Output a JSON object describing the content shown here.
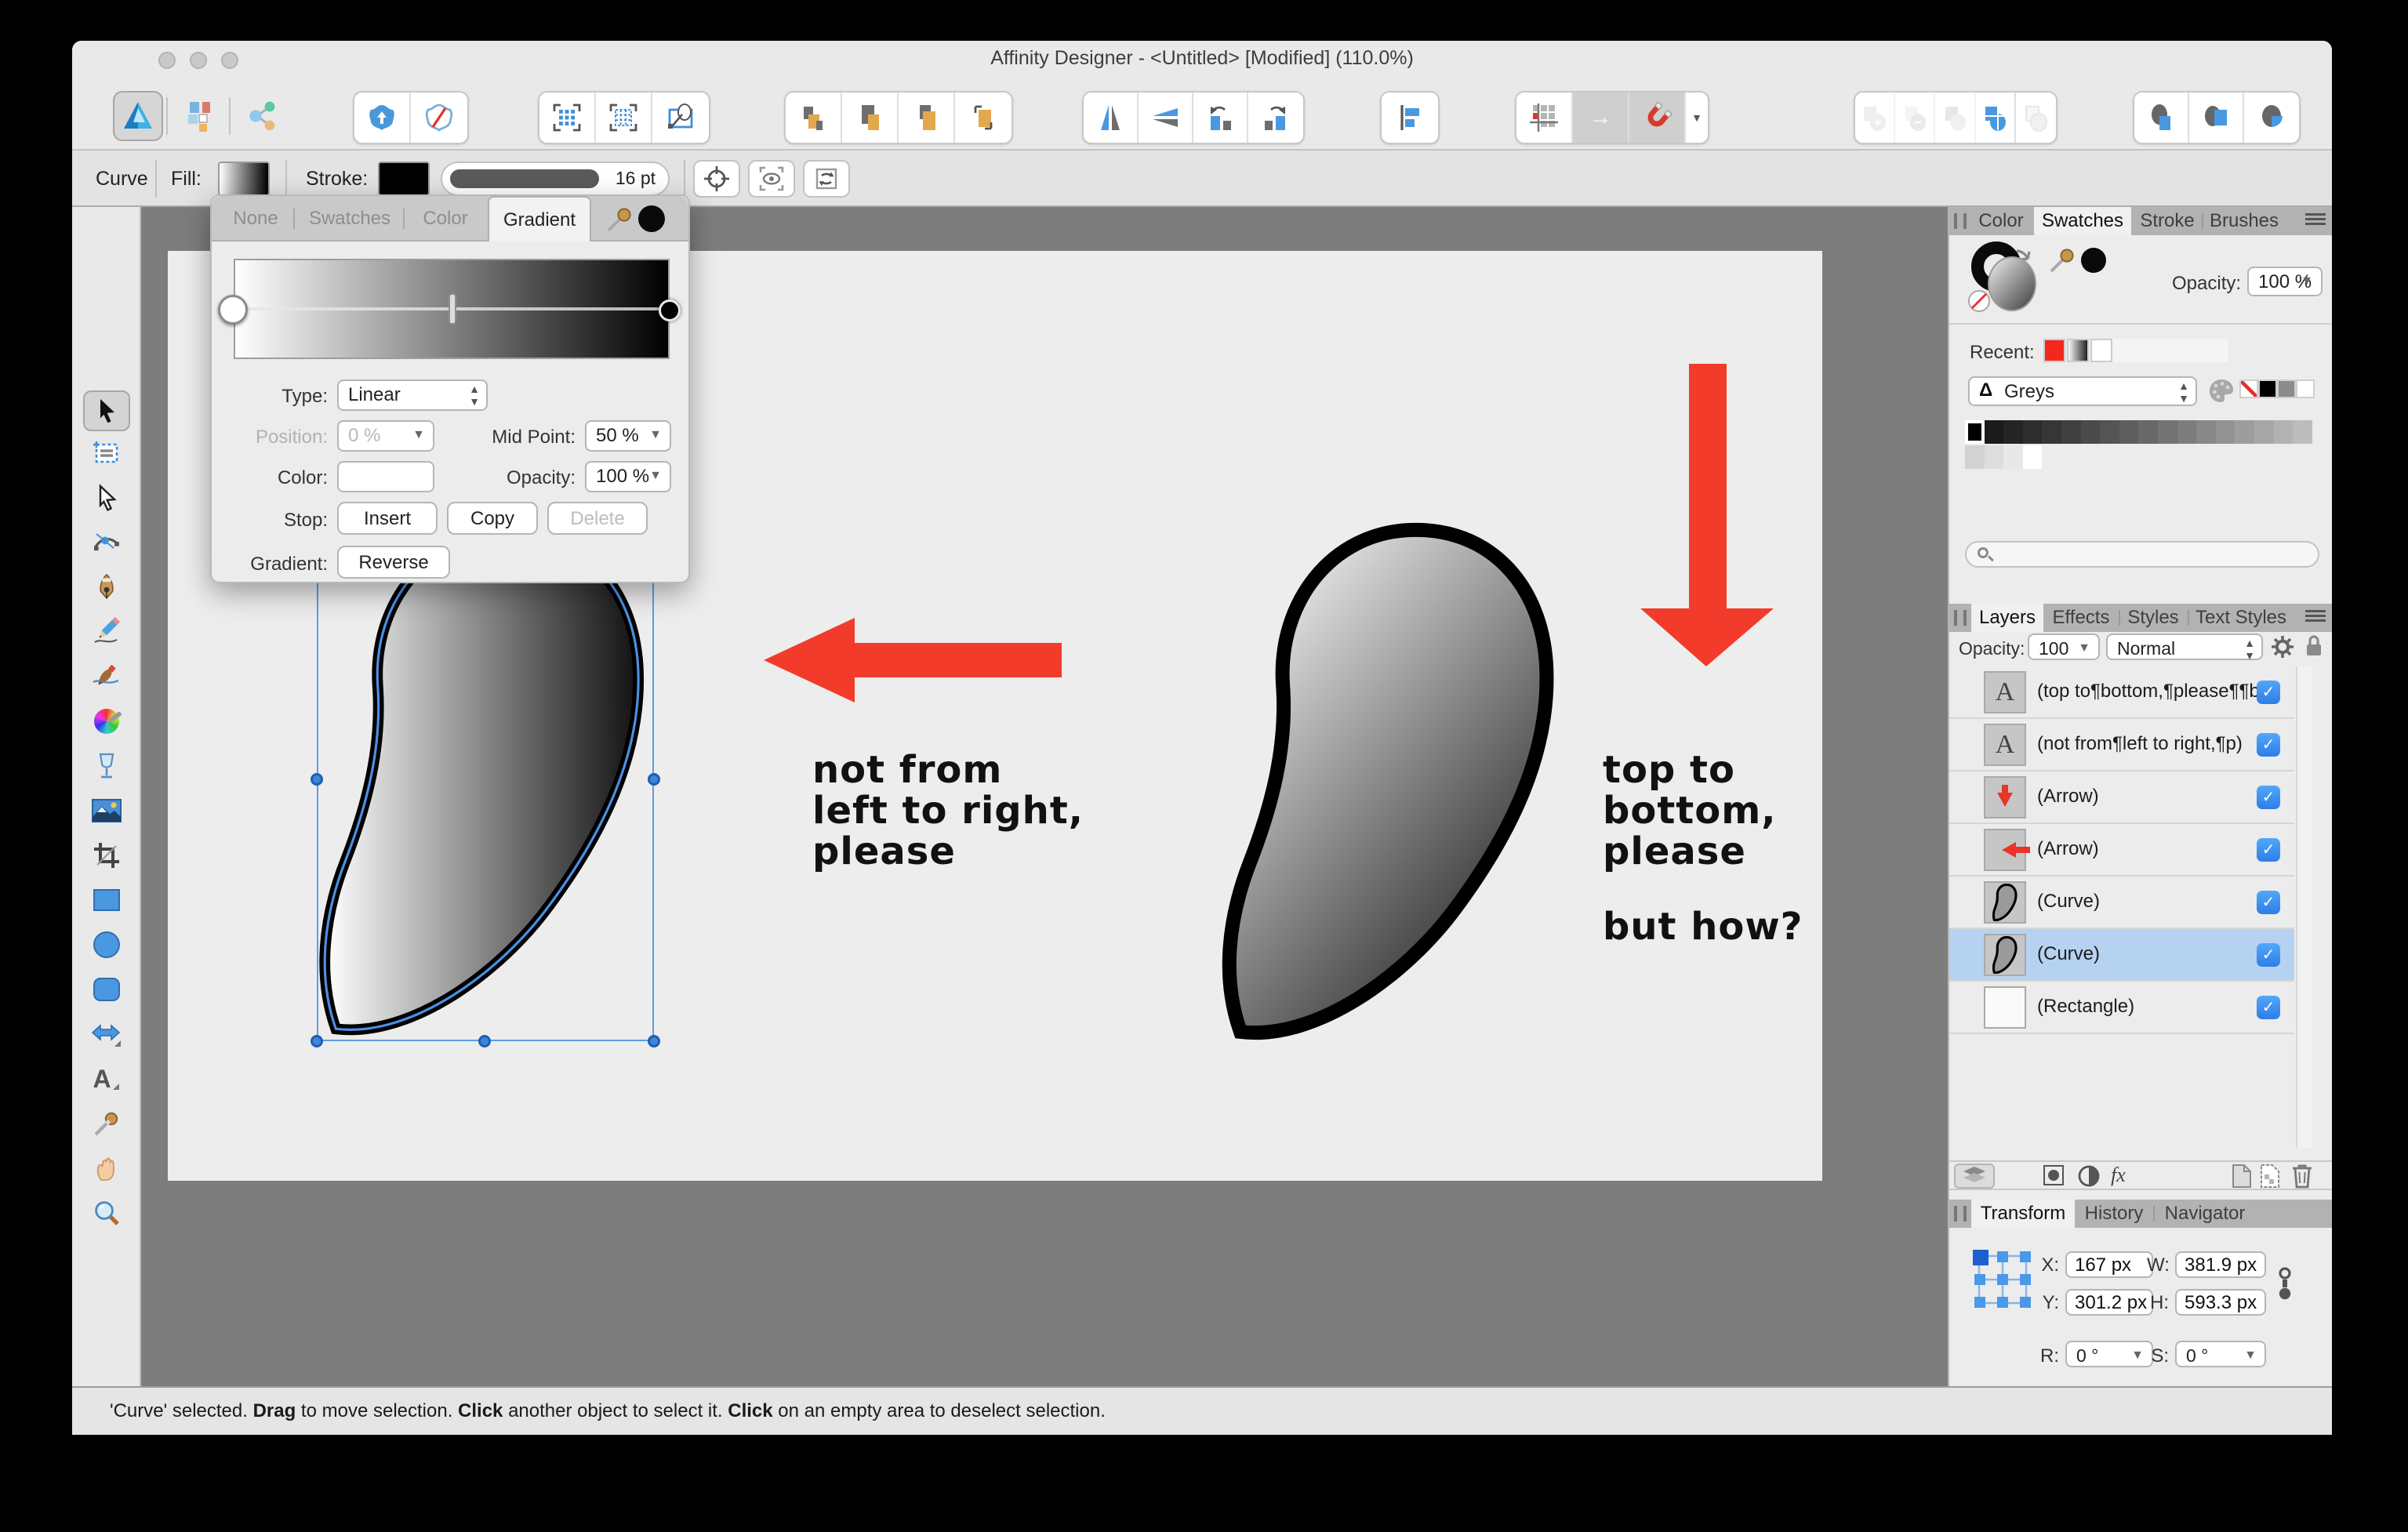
{
  "window": {
    "title": "Affinity Designer - <Untitled> [Modified] (110.0%)"
  },
  "icon_names": [
    "designer-persona-icon",
    "pixel-persona-icon",
    "export-persona-icon",
    "insert-inside-icon",
    "erase-icon",
    "select-box-icon",
    "select-marquee-icon",
    "lasso-transform-icon",
    "move-to-front-icon",
    "move-forward-icon",
    "move-backward-icon",
    "move-to-back-icon",
    "flip-horizontal-icon",
    "flip-vertical-icon",
    "rotate-ccw-icon",
    "rotate-cw-icon",
    "alignment-icon",
    "snap-grid-icon",
    "move-by-whole-pixels-icon",
    "snapping-icon",
    "boolean-add-icon",
    "boolean-subtract-icon",
    "boolean-intersect-icon",
    "boolean-divide-icon",
    "boolean-combine-icon",
    "insert-behind-icon",
    "insert-inside-target-icon",
    "insert-on-top-icon",
    "rotation-centre-icon",
    "cycle-selection-box-icon",
    "transform-objects-separately-icon",
    "eyedropper-icon",
    "hamburger-menu-icon",
    "gear-icon",
    "lock-icon",
    "layers-stack-icon",
    "mask-icon",
    "adjustment-icon",
    "fx-icon",
    "new-layer-icon",
    "new-pixel-layer-icon",
    "trash-icon",
    "link-icon",
    "search-icon",
    "palette-icon"
  ],
  "tools": [
    "move",
    "artboard",
    "node",
    "point-transform",
    "pen",
    "pencil",
    "vector-brush",
    "fill-gradient",
    "transparency",
    "place-image",
    "crop",
    "rectangle",
    "ellipse",
    "rounded-rectangle",
    "arrow-shape",
    "artistic-text",
    "colour-picker",
    "view-hand",
    "zoom"
  ],
  "context_toolbar": {
    "object_label": "Curve",
    "fill_label": "Fill:",
    "stroke_label": "Stroke:",
    "stroke_width": "16 pt"
  },
  "gradient_panel": {
    "tabs": [
      "None",
      "Swatches",
      "Color",
      "Gradient"
    ],
    "active_tab": "Gradient",
    "type_label": "Type:",
    "type_value": "Linear",
    "position_label": "Position:",
    "position_value": "0 %",
    "midpoint_label": "Mid Point:",
    "midpoint_value": "50 %",
    "color_label": "Color:",
    "opacity_label": "Opacity:",
    "opacity_value": "100 %",
    "stop_label": "Stop:",
    "insert_label": "Insert",
    "copy_label": "Copy",
    "delete_label": "Delete",
    "gradient_label": "Gradient:",
    "reverse_label": "Reverse",
    "gradient_stops": [
      "#ffffff",
      "#000000"
    ],
    "mid_point": "50%"
  },
  "canvas": {
    "left_note_lines": [
      "not from",
      "left to right,",
      "please"
    ],
    "right_note_lines": [
      "top to",
      "bottom,",
      "please"
    ],
    "question": "but how?",
    "arrow_color": "#f23b2b",
    "shape_gradient": [
      "#ffffff",
      "#111111"
    ]
  },
  "swatches_panel": {
    "tabs": [
      "Color",
      "Swatches",
      "Stroke",
      "Brushes"
    ],
    "active_tab": "Swatches",
    "opacity_label": "Opacity:",
    "opacity_value": "100 %",
    "recent_label": "Recent:",
    "recent_swatches": [
      "#f3281c",
      "gradient",
      "#ffffff"
    ],
    "category_value": "Greys",
    "mini_swatches": [
      "none",
      "#000000",
      "#8c8c8c",
      "#ffffff"
    ],
    "grid_row1": [
      "#000000",
      "#1b1b1b",
      "#242424",
      "#2d2d2d",
      "#363636",
      "#404040",
      "#4a4a4a",
      "#545454",
      "#5e5e5e",
      "#686868",
      "#737373",
      "#7d7d7d",
      "#888888",
      "#929292",
      "#9d9d9d",
      "#a7a7a7",
      "#b2b2b2",
      "#bcbcbc"
    ],
    "grid_row2": [
      "#d2d2d2",
      "#dddddd",
      "#e8e8e8",
      "#ffffff"
    ]
  },
  "layers_panel": {
    "tabs": [
      "Layers",
      "Effects",
      "Styles",
      "Text Styles"
    ],
    "active_tab": "Layers",
    "opacity_label": "Opacity:",
    "opacity_value": "100",
    "blend_mode": "Normal",
    "layers": [
      {
        "name": "(top to¶bottom,¶please¶¶bu)",
        "thumb": "text",
        "checked": true,
        "selected": false
      },
      {
        "name": "(not from¶left to right,¶p)",
        "thumb": "text",
        "checked": true,
        "selected": false
      },
      {
        "name": "(Arrow)",
        "thumb": "arrow-down",
        "checked": true,
        "selected": false
      },
      {
        "name": "(Arrow)",
        "thumb": "arrow-left",
        "checked": true,
        "selected": false
      },
      {
        "name": "(Curve)",
        "thumb": "curve",
        "checked": true,
        "selected": false
      },
      {
        "name": "(Curve)",
        "thumb": "curve",
        "checked": true,
        "selected": true
      },
      {
        "name": "(Rectangle)",
        "thumb": "rect",
        "checked": true,
        "selected": false
      }
    ]
  },
  "transform_panel": {
    "tabs": [
      "Transform",
      "History",
      "Navigator"
    ],
    "active_tab": "Transform",
    "x_label": "X:",
    "x_value": "167 px",
    "y_label": "Y:",
    "y_value": "301.2 px",
    "w_label": "W:",
    "w_value": "381.9 px",
    "h_label": "H:",
    "h_value": "593.3 px",
    "r_label": "R:",
    "r_value": "0 °",
    "s_label": "S:",
    "s_value": "0 °"
  },
  "status_bar": {
    "segments": [
      {
        "text": "'Curve' selected. ",
        "bold": false
      },
      {
        "text": "Drag",
        "bold": true
      },
      {
        "text": " to move selection. ",
        "bold": false
      },
      {
        "text": "Click",
        "bold": true
      },
      {
        "text": " another object to select it. ",
        "bold": false
      },
      {
        "text": "Click",
        "bold": true
      },
      {
        "text": " on an empty area to deselect selection.",
        "bold": false
      }
    ]
  }
}
